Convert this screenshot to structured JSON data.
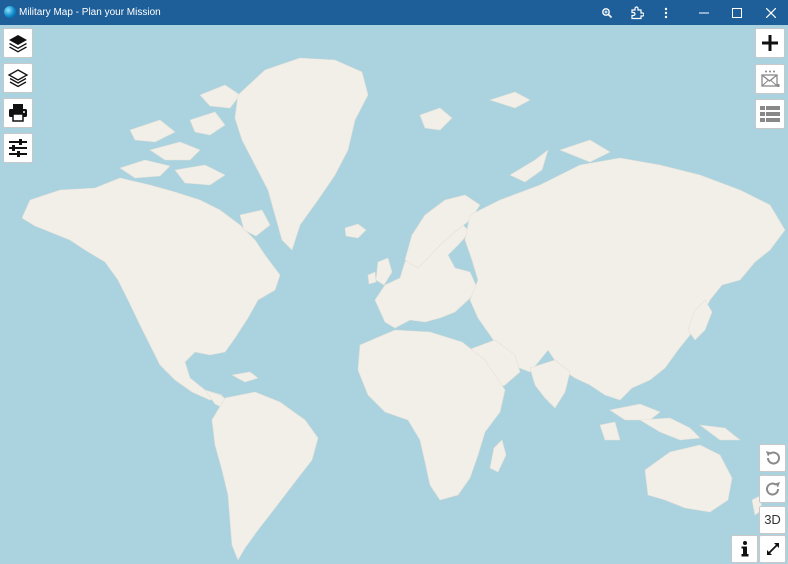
{
  "window": {
    "title": "Military Map - Plan your Mission",
    "controls": [
      "zoom-icon",
      "extension-icon",
      "more-vert-icon",
      "minimize-icon",
      "maximize-icon",
      "close-icon"
    ]
  },
  "toolbar_left": [
    {
      "name": "basemap-layers-button",
      "icon": "layers-filled-icon"
    },
    {
      "name": "overlay-layers-button",
      "icon": "layers-outline-icon"
    },
    {
      "name": "print-button",
      "icon": "printer-icon"
    },
    {
      "name": "settings-button",
      "icon": "sliders-icon"
    }
  ],
  "toolbar_right": [
    {
      "name": "add-button",
      "icon": "plus-icon"
    },
    {
      "name": "messages-button",
      "icon": "envelope-icon"
    },
    {
      "name": "list-button",
      "icon": "list-icon"
    }
  ],
  "map_controls": {
    "undo_icon": "undo-icon",
    "redo_icon": "redo-icon",
    "three_d_label": "3D",
    "info_icon": "info-icon",
    "fullscreen_icon": "expand-icon"
  },
  "colors": {
    "titlebar": "#1f5f99",
    "water": "#aad3df",
    "land": "#f2efe9"
  }
}
